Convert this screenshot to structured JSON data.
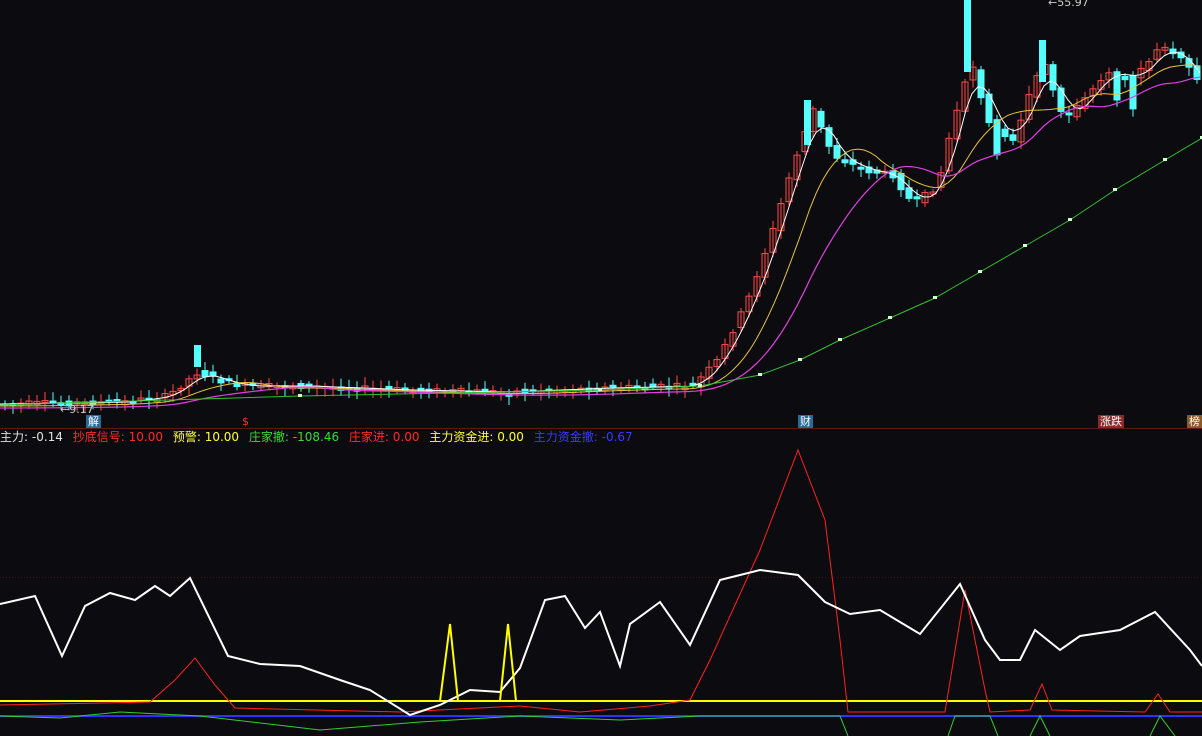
{
  "colors": {
    "background": "#0c0b0f",
    "up_candle": "#ff4a4a",
    "down_candle": "#54ffff",
    "ma5": "#ffffff",
    "ma10": "#e8c23c",
    "ma20": "#e040e0",
    "ma60": "#30c030",
    "zhuli": "#ffffff",
    "chaodi": "#ff2020",
    "yujing": "#ffff00",
    "zhuangjia_che": "#30d030",
    "zhuangjia_jin": "#ff2020",
    "zhuli_zijin_jin": "#ffff00",
    "zhuli_zijin_che": "#3030ff"
  },
  "price_labels": {
    "high": "55.97",
    "low": "9.17"
  },
  "event_tags": [
    {
      "text": "解",
      "color": "#ffffff",
      "bg": "#2a6a9a"
    },
    {
      "text": "$",
      "color": "#ff3030",
      "bg": ""
    },
    {
      "text": "财",
      "color": "#ffffff",
      "bg": "#2a6a9a"
    },
    {
      "text": "涨跌",
      "color": "#ffffff",
      "bg": "#8a2a2a"
    },
    {
      "text": "榜",
      "color": "#ffffff",
      "bg": "#8a5a2a"
    }
  ],
  "indicators": [
    {
      "label": "主力:",
      "value": "-0.14",
      "color": "#e0e0e0"
    },
    {
      "label": "抄底信号:",
      "value": "10.00",
      "color": "#ff2a2a"
    },
    {
      "label": "预警:",
      "value": "10.00",
      "color": "#ffff3a"
    },
    {
      "label": "庄家撤:",
      "value": "-108.46",
      "color": "#3ad83a"
    },
    {
      "label": "庄家进:",
      "value": "0.00",
      "color": "#ff2a2a"
    },
    {
      "label": "主力资金进:",
      "value": "0.00",
      "color": "#ffff3a"
    },
    {
      "label": "主力资金撤:",
      "value": "-0.67",
      "color": "#3a3aff"
    }
  ]
}
